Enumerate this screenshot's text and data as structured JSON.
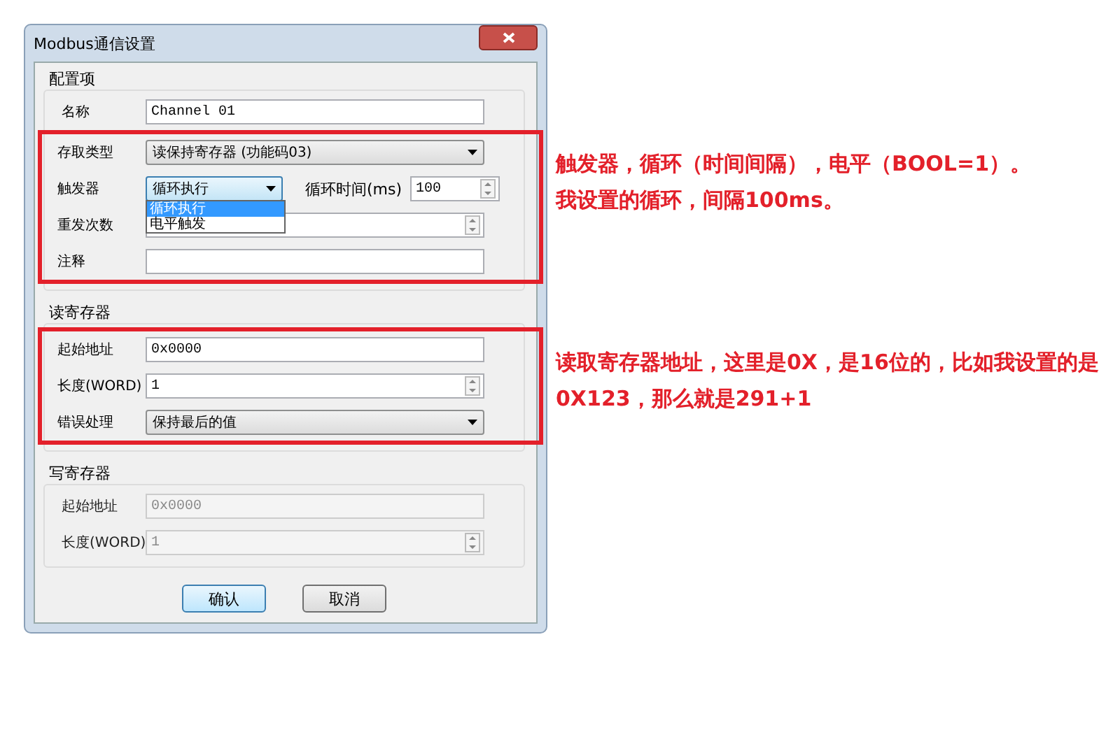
{
  "window": {
    "title": "Modbus通信设置"
  },
  "groups": [
    {
      "title": "配置项",
      "fields": [
        {
          "kind": "text",
          "label": "名称",
          "value": "Channel 01",
          "disabled": false,
          "highlighted": false
        },
        {
          "kind": "dropdown",
          "label": "存取类型",
          "value": "读保持寄存器 (功能码03)",
          "disabled": false,
          "highlighted": true
        },
        {
          "kind": "trigger",
          "label": "触发器",
          "value": "循环执行",
          "disabled": false,
          "highlighted": true,
          "interval_label": "循环时间(ms)",
          "interval_value": "100",
          "options": [
            {
              "label": "循环执行",
              "selected": true
            },
            {
              "label": "电平触发",
              "selected": false
            }
          ]
        },
        {
          "kind": "spin",
          "label": "重发次数",
          "disabled": false,
          "highlighted": true
        },
        {
          "kind": "text",
          "label": "注释",
          "disabled": false,
          "highlighted": true
        }
      ]
    },
    {
      "title": "读寄存器",
      "fields": [
        {
          "kind": "text",
          "label": "起始地址",
          "value": "0x0000",
          "disabled": false,
          "highlighted": true
        },
        {
          "kind": "spin",
          "label": "长度(WORD)",
          "value": "1",
          "disabled": false,
          "highlighted": true
        },
        {
          "kind": "dropdown",
          "label": "错误处理",
          "value": "保持最后的值",
          "disabled": false,
          "highlighted": true
        }
      ]
    },
    {
      "title": "写寄存器",
      "fields": [
        {
          "kind": "text",
          "label": "起始地址",
          "value": "0x0000",
          "disabled": true,
          "highlighted": false
        },
        {
          "kind": "spin",
          "label": "长度(WORD)",
          "value": "1",
          "disabled": true,
          "highlighted": false
        }
      ]
    }
  ],
  "buttons": [
    {
      "label": "确认",
      "default": true
    },
    {
      "label": "取消",
      "default": false
    }
  ],
  "annotations": [
    {
      "lines": [
        "触发器，循环（时间间隔），电平（BOOL=1）。",
        "我设置的循环，间隔100ms。"
      ]
    },
    {
      "lines": [
        "读取寄存器地址，这里是0X，是16位的，比如我设置的是0X123，那么就是291+1"
      ]
    }
  ]
}
